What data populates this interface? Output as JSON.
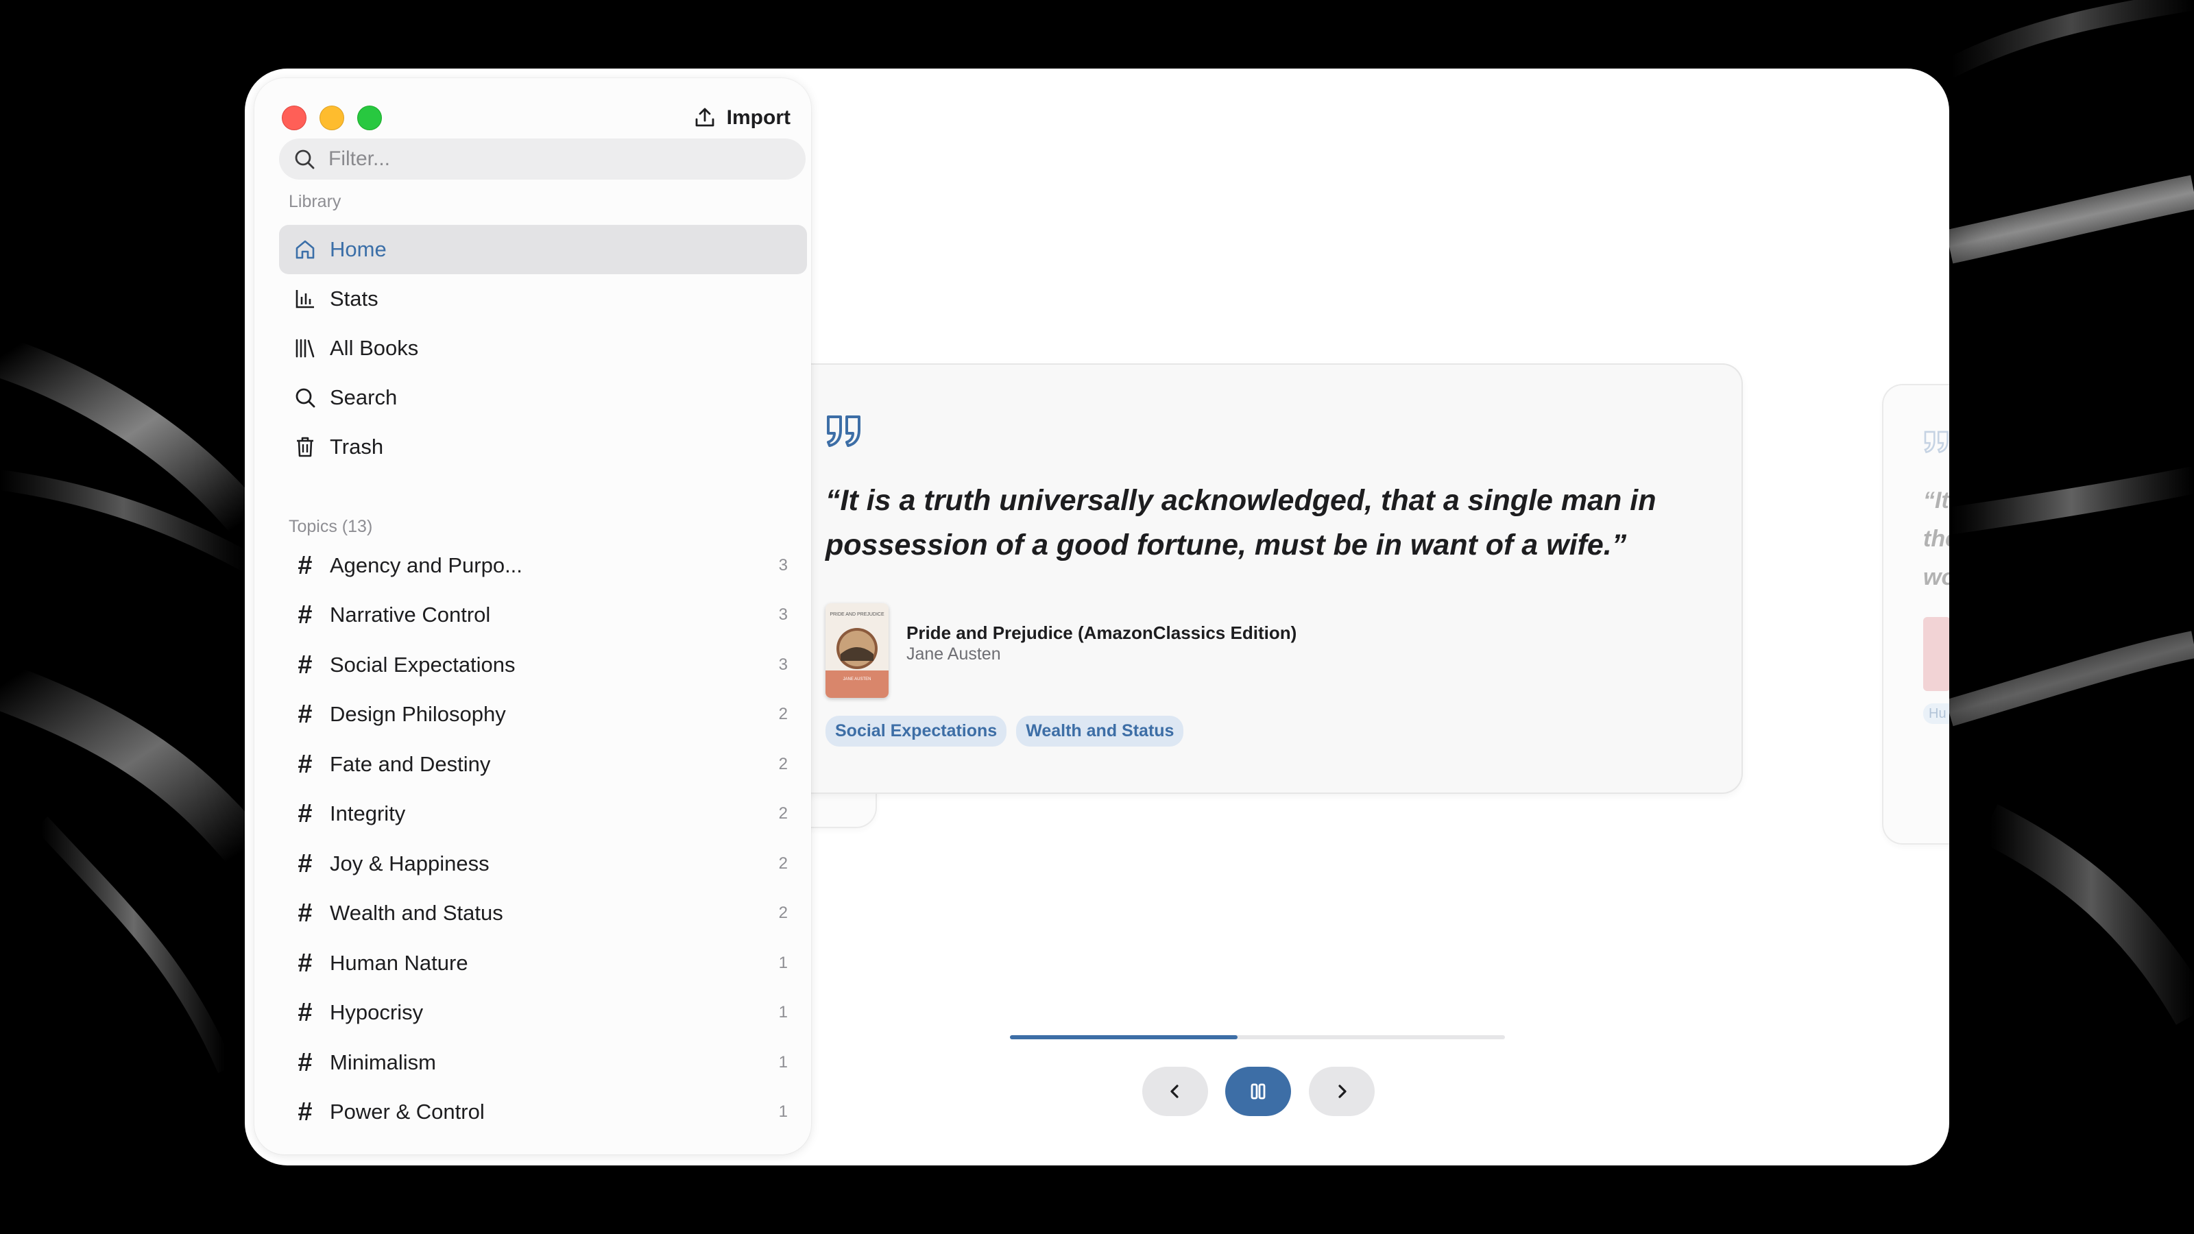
{
  "window": {
    "import_label": "Import",
    "filter_placeholder": "Filter..."
  },
  "sidebar": {
    "library_label": "Library",
    "nav": [
      {
        "label": "Home",
        "icon": "home-icon",
        "active": true
      },
      {
        "label": "Stats",
        "icon": "stats-icon"
      },
      {
        "label": "All Books",
        "icon": "books-icon"
      },
      {
        "label": "Search",
        "icon": "search-icon"
      },
      {
        "label": "Trash",
        "icon": "trash-icon"
      }
    ],
    "topics_label": "Topics (13)",
    "topics": [
      {
        "name": "Agency and Purpo...",
        "count": "3"
      },
      {
        "name": "Narrative Control",
        "count": "3"
      },
      {
        "name": "Social Expectations",
        "count": "3"
      },
      {
        "name": "Design Philosophy",
        "count": "2"
      },
      {
        "name": "Fate and Destiny",
        "count": "2"
      },
      {
        "name": "Integrity",
        "count": "2"
      },
      {
        "name": "Joy & Happiness",
        "count": "2"
      },
      {
        "name": "Wealth and Status",
        "count": "2"
      },
      {
        "name": "Human Nature",
        "count": "1"
      },
      {
        "name": "Hypocrisy",
        "count": "1"
      },
      {
        "name": "Minimalism",
        "count": "1"
      },
      {
        "name": "Power & Control",
        "count": "1"
      }
    ]
  },
  "highlight": {
    "quote": "“It is a truth universally acknowledged, that a single man in possession of a good fortune, must be in want of a wife.”",
    "book_title": "Pride and Prejudice (AmazonClassics Edition)",
    "author": "Jane Austen",
    "cover_title": "PRIDE AND PREJUDICE",
    "cover_author": "JANE AUSTEN",
    "tags": [
      "Social Expectations",
      "Wealth and Status"
    ]
  },
  "ghost_right": {
    "text_lines": [
      "“It",
      "the",
      "wo"
    ],
    "tag": "Hu"
  },
  "carousel": {
    "progress": 0.46
  },
  "colors": {
    "accent": "#3d6ea6",
    "tag_bg": "#dde7f3"
  }
}
